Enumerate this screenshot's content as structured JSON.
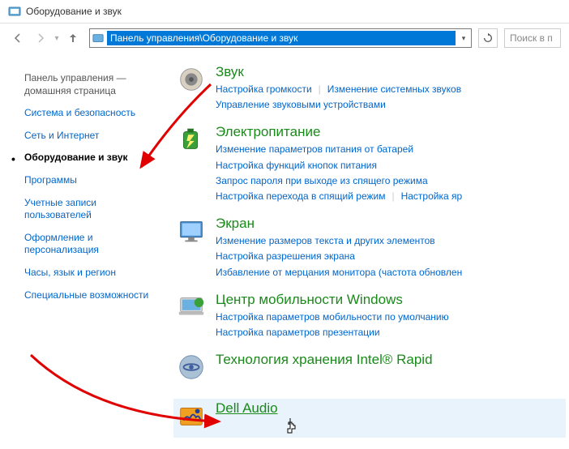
{
  "window": {
    "title": "Оборудование и звук"
  },
  "address": {
    "path": "Панель управления\\Оборудование и звук"
  },
  "search": {
    "placeholder": "Поиск в п"
  },
  "sidebar": {
    "home": "Панель управления — домашняя страница",
    "items": [
      "Система и безопасность",
      "Сеть и Интернет",
      "Оборудование и звук",
      "Программы",
      "Учетные записи пользователей",
      "Оформление и персонализация",
      "Часы, язык и регион",
      "Специальные возможности"
    ]
  },
  "categories": [
    {
      "title": "Звук",
      "links": [
        "Настройка громкости",
        "Изменение системных звуков",
        "Управление звуковыми устройствами"
      ]
    },
    {
      "title": "Электропитание",
      "links": [
        "Изменение параметров питания от батарей",
        "Настройка функций кнопок питания",
        "Запрос пароля при выходе из спящего режима",
        "Настройка перехода в спящий режим",
        "Настройка яр"
      ]
    },
    {
      "title": "Экран",
      "links": [
        "Изменение размеров текста и других элементов",
        "Настройка разрешения экрана",
        "Избавление от мерцания монитора (частота обновлен"
      ]
    },
    {
      "title": "Центр мобильности Windows",
      "links": [
        "Настройка параметров мобильности по умолчанию",
        "Настройка параметров презентации"
      ]
    },
    {
      "title": "Технология хранения Intel® Rapid",
      "links": []
    },
    {
      "title": "Dell Audio",
      "links": []
    }
  ]
}
